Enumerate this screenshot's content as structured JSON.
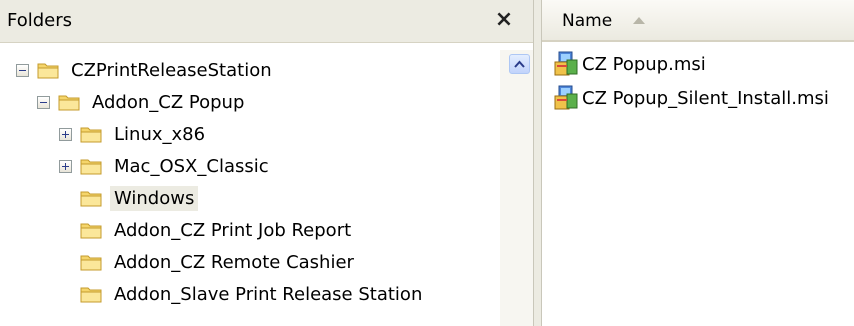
{
  "folders_pane": {
    "title": "Folders",
    "close_glyph": "×",
    "tree": [
      {
        "label": "CZPrintReleaseStation",
        "expander": "minus",
        "selected": false
      },
      {
        "label": "Addon_CZ Popup",
        "expander": "minus",
        "selected": false
      },
      {
        "label": "Linux_x86",
        "expander": "plus",
        "selected": false
      },
      {
        "label": "Mac_OSX_Classic",
        "expander": "plus",
        "selected": false
      },
      {
        "label": "Windows",
        "expander": "none",
        "selected": true
      },
      {
        "label": "Addon_CZ Print Job Report",
        "expander": "none",
        "selected": false
      },
      {
        "label": "Addon_CZ Remote Cashier",
        "expander": "none",
        "selected": false
      },
      {
        "label": "Addon_Slave Print Release Station",
        "expander": "none",
        "selected": false
      }
    ]
  },
  "files_pane": {
    "column_name": "Name",
    "sort": "ascending",
    "files": [
      {
        "name": "CZ Popup.msi",
        "icon": "msi-installer-icon"
      },
      {
        "name": "CZ Popup_Silent_Install.msi",
        "icon": "msi-installer-icon"
      }
    ]
  },
  "colors": {
    "header_bg": "#ecebe2",
    "folder_yellow": "#f5d56b",
    "scroll_blue": "#c1d3fb"
  }
}
